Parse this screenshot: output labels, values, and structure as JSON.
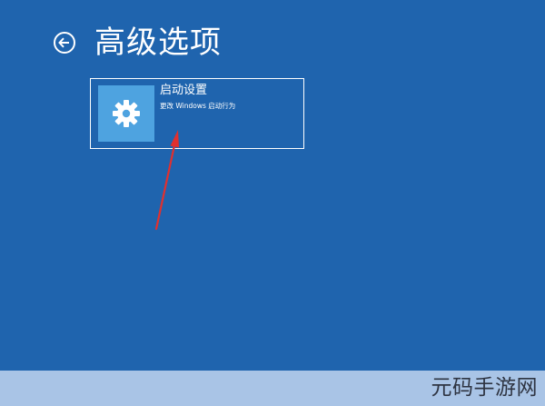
{
  "header": {
    "back_icon": "back-arrow-icon",
    "title": "高级选项"
  },
  "options": [
    {
      "icon": "gear-icon",
      "title": "启动设置",
      "subtitle": "更改 Windows 启动行为"
    }
  ],
  "watermark": {
    "text": "元码手游网"
  },
  "colors": {
    "background": "#1f64ae",
    "tile_icon_bg": "#4ea3e0",
    "annotation_arrow": "#e0302f",
    "bottom_strip": "#a9c4e6"
  }
}
